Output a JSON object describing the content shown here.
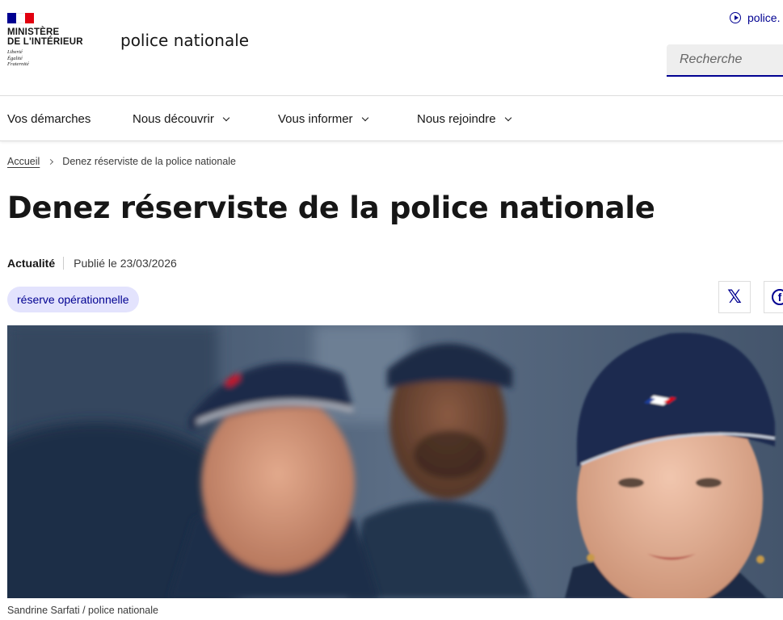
{
  "header": {
    "ministry_line1": "MINISTÈRE",
    "ministry_line2": "DE L'INTÉRIEUR",
    "motto_1": "Liberté",
    "motto_2": "Égalité",
    "motto_3": "Fraternité",
    "service_title": "police nationale",
    "quick_link": "police.",
    "search_placeholder": "Recherche",
    "flag_colors": [
      "#000091",
      "#ffffff",
      "#e1000f"
    ]
  },
  "nav": {
    "items": [
      {
        "label": "Vos démarches",
        "has_dropdown": false
      },
      {
        "label": "Nous découvrir",
        "has_dropdown": true
      },
      {
        "label": "Vous informer",
        "has_dropdown": true
      },
      {
        "label": "Nous rejoindre",
        "has_dropdown": true
      }
    ]
  },
  "breadcrumb": {
    "home": "Accueil",
    "current": "Denez réserviste de la police nationale"
  },
  "article": {
    "title": "Denez réserviste de la police nationale",
    "type": "Actualité",
    "published": "Publié le 23/03/2026",
    "tag": "réserve opérationnelle",
    "share_x_icon": "x-icon",
    "share_facebook_icon": "facebook-icon",
    "image_caption": "Sandrine Sarfati / police nationale"
  },
  "colors": {
    "accent": "#000091",
    "tag_bg": "#e3e3fd",
    "text": "#161616"
  }
}
